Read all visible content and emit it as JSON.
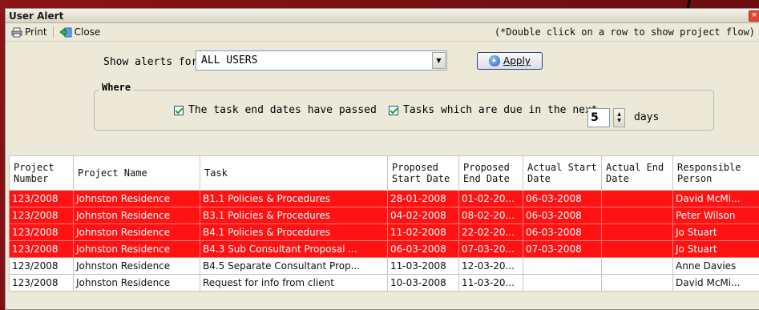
{
  "window": {
    "title": "User Alert"
  },
  "toolbar": {
    "print_label": "Print",
    "close_label": "Close",
    "hint": "(*Double click on a row to show project flow)"
  },
  "filter": {
    "show_label": "Show alerts for",
    "show_value": "ALL USERS",
    "apply_label": "Apply",
    "where_title": "Where",
    "cb1_label": "The task end dates have passed",
    "cb1_checked": true,
    "cb2_label": "Tasks which are due in the next",
    "cb2_checked": true,
    "days_value": "5",
    "days_label": "days"
  },
  "table": {
    "columns": [
      {
        "line1": "Project",
        "line2": "Number"
      },
      {
        "line1": "Project Name",
        "line2": ""
      },
      {
        "line1": "Task",
        "line2": ""
      },
      {
        "line1": "Proposed",
        "line2": "Start Date"
      },
      {
        "line1": "Proposed",
        "line2": "End Date"
      },
      {
        "line1": "Actual Start",
        "line2": "Date"
      },
      {
        "line1": "Actual End",
        "line2": "Date"
      },
      {
        "line1": "Responsible",
        "line2": "Person"
      }
    ],
    "rows": [
      {
        "alert": true,
        "cells": [
          "123/2008",
          "Johnston Residence",
          "B1.1 Policies & Procedures",
          "28-01-2008",
          "01-02-20...",
          "06-03-2008",
          "",
          "David McMi..."
        ]
      },
      {
        "alert": true,
        "cells": [
          "123/2008",
          "Johnston Residence",
          "B3.1 Policies & Procedures",
          "04-02-2008",
          "08-02-20...",
          "06-03-2008",
          "",
          "Peter Wilson"
        ]
      },
      {
        "alert": true,
        "cells": [
          "123/2008",
          "Johnston Residence",
          "B4.1 Policies & Procedures",
          "11-02-2008",
          "22-02-20...",
          "06-03-2008",
          "",
          "Jo Stuart"
        ]
      },
      {
        "alert": true,
        "cells": [
          "123/2008",
          "Johnston Residence",
          "B4.3 Sub Consultant Proposal ...",
          "06-03-2008",
          "07-03-20...",
          "07-03-2008",
          "",
          "Jo Stuart"
        ]
      },
      {
        "alert": false,
        "cells": [
          "123/2008",
          "Johnston Residence",
          "B4.5 Separate Consultant Prop...",
          "11-03-2008",
          "12-03-20...",
          "",
          "",
          "Anne Davies"
        ]
      },
      {
        "alert": false,
        "cells": [
          "123/2008",
          "Johnston Residence",
          "Request for info from client",
          "10-03-2008",
          "11-03-20...",
          "",
          "",
          "David McMi..."
        ]
      }
    ]
  },
  "colors": {
    "alert_row": "#ff1212",
    "background": "#7a0e10",
    "window": "#ece9d8"
  },
  "icons": {
    "print": "printer-icon",
    "close": "close-door-icon",
    "apply": "apply-icon",
    "dropdown": "chevron-down-icon"
  }
}
